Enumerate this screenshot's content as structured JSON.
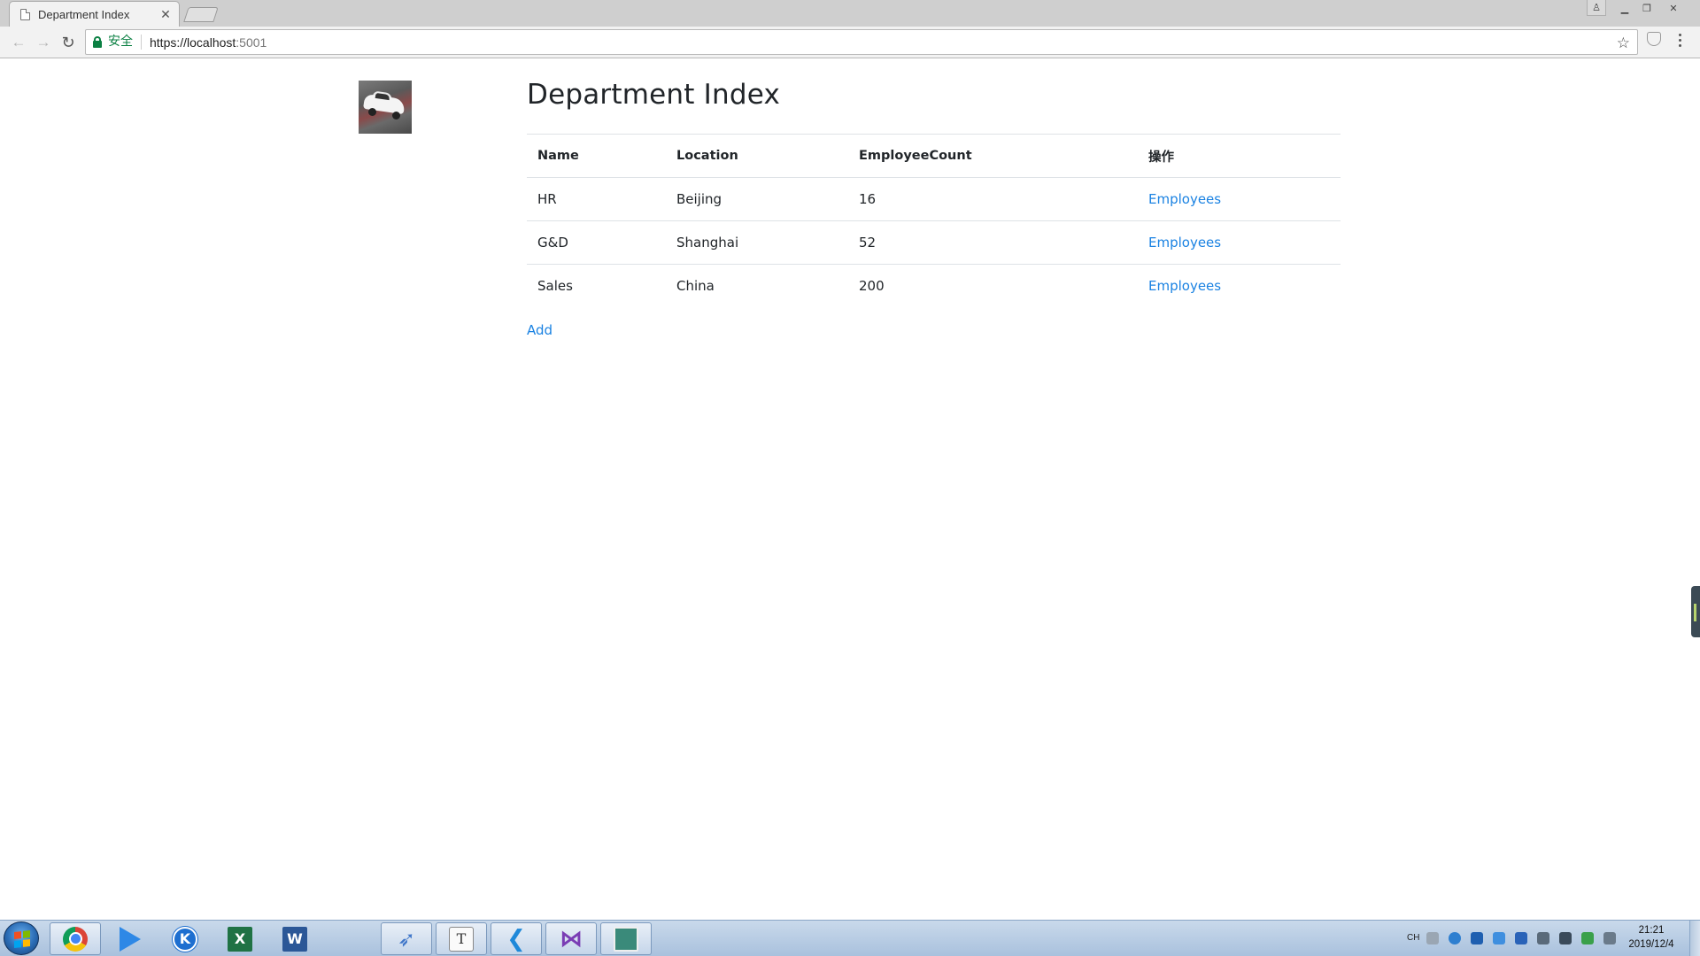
{
  "browser": {
    "tab_title": "Department Index",
    "secure_label": "安全",
    "url_host": "https://localhost",
    "url_port": ":5001"
  },
  "page": {
    "title": "Department Index",
    "table": {
      "headers": [
        "Name",
        "Location",
        "EmployeeCount",
        "操作"
      ],
      "rows": [
        {
          "name": "HR",
          "location": "Beijing",
          "count": "16",
          "action": "Employees"
        },
        {
          "name": "G&D",
          "location": "Shanghai",
          "count": "52",
          "action": "Employees"
        },
        {
          "name": "Sales",
          "location": "China",
          "count": "200",
          "action": "Employees"
        }
      ]
    },
    "add_link": "Add"
  },
  "taskbar": {
    "apps": [
      "chrome-icon",
      "media-player-icon",
      "kk-icon",
      "excel-icon",
      "word-icon",
      "tiles-app-icon",
      "bird-app-icon",
      "typora-icon",
      "vscode-icon",
      "visual-studio-icon",
      "desktop-app-icon"
    ],
    "tray_lang": "CH",
    "clock_time": "21:21",
    "clock_date": "2019/12/4"
  },
  "colors": {
    "link": "#1a82e2",
    "secure": "#0b8043",
    "text": "#212529"
  }
}
